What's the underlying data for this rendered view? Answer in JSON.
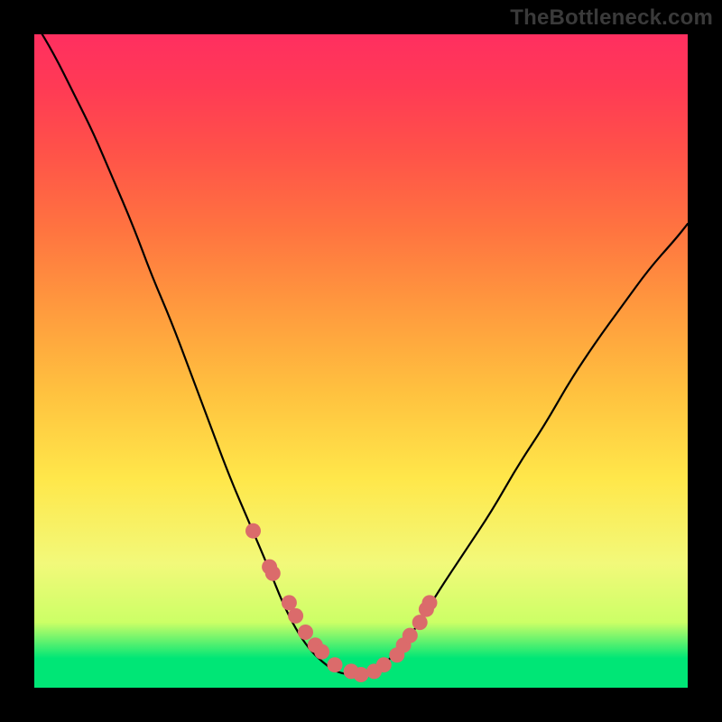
{
  "watermark": "TheBottleneck.com",
  "chart_data": {
    "type": "line",
    "title": "",
    "xlabel": "",
    "ylabel": "",
    "xlim": [
      0,
      1
    ],
    "ylim": [
      0,
      1
    ],
    "x": [
      0.0,
      0.03,
      0.06,
      0.09,
      0.12,
      0.15,
      0.18,
      0.21,
      0.24,
      0.27,
      0.3,
      0.33,
      0.36,
      0.38,
      0.4,
      0.42,
      0.44,
      0.46,
      0.48,
      0.5,
      0.52,
      0.54,
      0.56,
      0.59,
      0.62,
      0.66,
      0.7,
      0.74,
      0.78,
      0.82,
      0.86,
      0.9,
      0.94,
      0.98,
      1.0
    ],
    "values": [
      1.02,
      0.97,
      0.91,
      0.85,
      0.78,
      0.71,
      0.63,
      0.56,
      0.48,
      0.4,
      0.32,
      0.25,
      0.18,
      0.13,
      0.09,
      0.06,
      0.04,
      0.025,
      0.02,
      0.02,
      0.025,
      0.04,
      0.06,
      0.1,
      0.15,
      0.21,
      0.27,
      0.34,
      0.4,
      0.47,
      0.53,
      0.585,
      0.64,
      0.685,
      0.71
    ],
    "markers": {
      "x": [
        0.335,
        0.36,
        0.365,
        0.39,
        0.4,
        0.415,
        0.43,
        0.44,
        0.46,
        0.485,
        0.5,
        0.52,
        0.535,
        0.555,
        0.565,
        0.575,
        0.59,
        0.6,
        0.605
      ],
      "y": [
        0.24,
        0.185,
        0.175,
        0.13,
        0.11,
        0.085,
        0.065,
        0.055,
        0.035,
        0.025,
        0.02,
        0.025,
        0.035,
        0.05,
        0.065,
        0.08,
        0.1,
        0.12,
        0.13
      ]
    },
    "marker_color": "#db6b6b",
    "line_color": "#000000",
    "background_gradient": [
      "#00e676",
      "#ffe74a",
      "#ff9a3e",
      "#ff2f60"
    ]
  }
}
